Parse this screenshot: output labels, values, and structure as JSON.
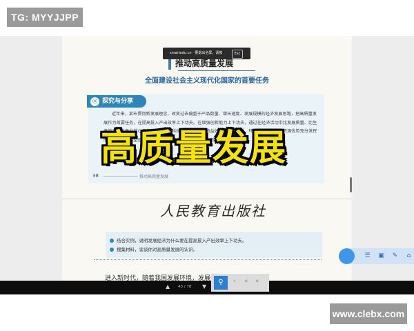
{
  "watermarks": {
    "top_left": "TG: MYYJJPP",
    "bottom_right": "www.clebx.com"
  },
  "viewer": {
    "fullscreen_bar": {
      "message": "smartedu.cn · 要退出全屏，请按",
      "esc_key": "Esc"
    },
    "section": {
      "title": "推动高质量发展",
      "subtitle": "全面建设社会主义现代化国家的首要任务"
    },
    "explore_box": {
      "title": "探究与分享",
      "text": "近年来，某市贯彻新发展理念，改变过去偏重于产品数量、增长速度、发展规模的经济发展思路，把高质量发展作为首要任务，在提高投入产出效率上下功夫。在增强创新能力上下功夫，通过在经济活动中比发展质量、比生产效率、比产业核心竞争力，实现了科技含量高、经济效益好、资源消耗低、环境污染少、人力资源优势充分发挥的发展，产业转型迈出坚实步伐，地区生产总值连年迈上新台阶。"
    },
    "prev_page_number": "38",
    "prev_page_footer": "推动高质量发展",
    "overlay_caption": "高质量发展",
    "publisher": "人民教育出版社",
    "notes": [
      "结合实例，说明发展经济为什么要在提高投入产出效率上下功夫。",
      "搜集材料，谈谈你对高质量发展的认识。"
    ],
    "body_text": "进入新时代，随着我国发展环境，发展条",
    "page_indicator": "43 / 78",
    "toolbar_icons": [
      "menu-icon",
      "page-icon",
      "pen-icon",
      "home-icon"
    ]
  }
}
